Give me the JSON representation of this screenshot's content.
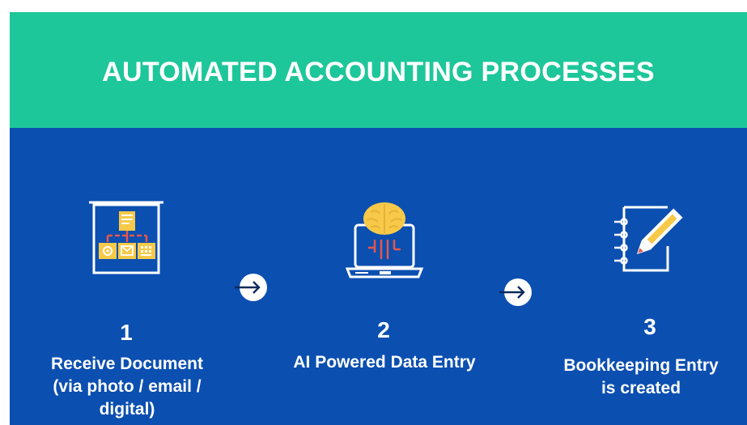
{
  "header": {
    "title": "AUTOMATED ACCOUNTING PROCESSES"
  },
  "steps": [
    {
      "number": "1",
      "label_lines": [
        "Receive Document",
        "(via photo / email /",
        "digital)"
      ],
      "icon": "document-workflow-icon"
    },
    {
      "number": "2",
      "label_lines": [
        "AI Powered Data Entry"
      ],
      "icon": "ai-brain-laptop-icon"
    },
    {
      "number": "3",
      "label_lines": [
        "Bookkeeping Entry",
        "is created"
      ],
      "icon": "notebook-pencil-icon"
    }
  ],
  "colors": {
    "header_bg": "#1dc79a",
    "body_bg": "#0b4fb0",
    "icon_stroke": "#ffffff",
    "accent_yellow": "#f7c948",
    "accent_red": "#e8564a"
  }
}
